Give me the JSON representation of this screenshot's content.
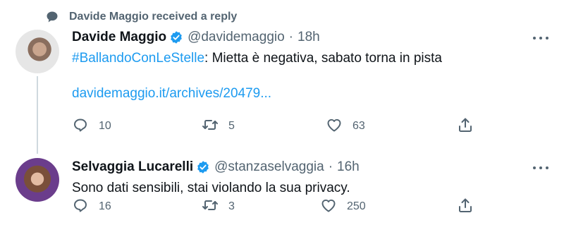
{
  "context": {
    "text": "Davide Maggio received a reply"
  },
  "tweets": [
    {
      "name": "Davide Maggio",
      "handle": "@davidemaggio",
      "dot": "·",
      "time": "18h",
      "hashtag": "#BallandoConLeStelle",
      "text": ": Mietta è negativa, sabato torna in pista",
      "link": "davidemaggio.it/archives/20479...",
      "replies": "10",
      "retweets": "5",
      "likes": "63"
    },
    {
      "name": "Selvaggia Lucarelli",
      "handle": "@stanzaselvaggia",
      "dot": "·",
      "time": "16h",
      "text": "Sono dati sensibili, stai violando la sua privacy.",
      "replies": "16",
      "retweets": "3",
      "likes": "250"
    }
  ],
  "colors": {
    "accent": "#1d9bf0",
    "muted": "#536471",
    "text": "#0f1419",
    "verified": "#1d9bf0"
  },
  "icons": [
    "speech-bubble-icon",
    "verified-badge-icon",
    "more-icon",
    "reply-icon",
    "retweet-icon",
    "like-icon",
    "share-icon"
  ]
}
